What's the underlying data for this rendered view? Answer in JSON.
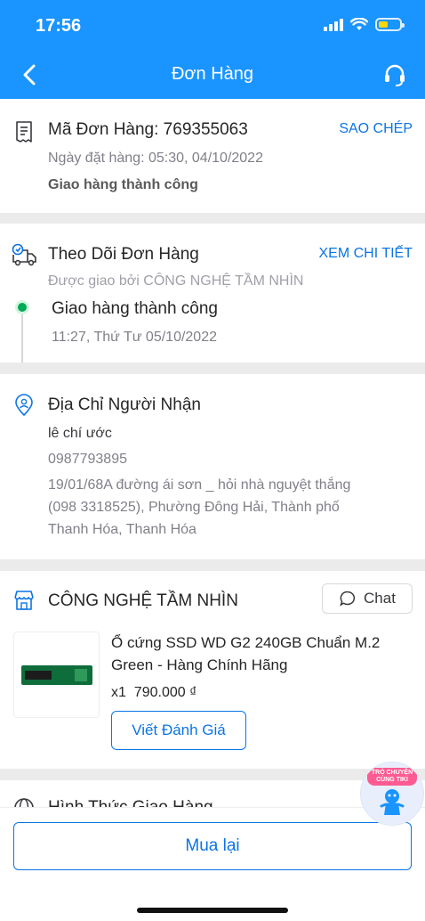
{
  "status_bar": {
    "time": "17:56"
  },
  "header": {
    "title": "Đơn Hàng"
  },
  "order": {
    "code_label": "Mã Đơn Hàng: 769355063",
    "copy_label": "SAO CHÉP",
    "order_date": "Ngày đặt hàng: 05:30, 04/10/2022",
    "status": "Giao hàng thành công"
  },
  "tracking": {
    "title": "Theo Dõi Đơn Hàng",
    "detail_label": "XEM CHI TIẾT",
    "carrier": "Được giao bởi CÔNG NGHỆ TẦM NHÌN",
    "event_status": "Giao hàng thành công",
    "event_time": "11:27, Thứ Tư 05/10/2022"
  },
  "address": {
    "title": "Địa Chỉ Người Nhận",
    "name": "lê chí ước",
    "phone": "0987793895",
    "line1": "19/01/68A đường ái sơn _ hỏi nhà nguyệt thắng",
    "line2": "(098 3318525), Phường Đông Hải, Thành phố",
    "line3": "Thanh Hóa, Thanh Hóa"
  },
  "shop": {
    "name": "CÔNG NGHỆ TẦM NHÌN",
    "chat_label": "Chat",
    "product": {
      "name_line1": "Ổ cứng SSD WD G2 240GB Chuẩn M.2",
      "name_line2": "Green - Hàng Chính Hãng",
      "quantity": "x1",
      "price": "790.000 ₫"
    },
    "review_label": "Viết Đánh Giá"
  },
  "shipping": {
    "title": "Hình Thức Giao Hàng"
  },
  "mascot": {
    "line1": "TRÒ CHUYỆN",
    "line2": "CÙNG TIKI"
  },
  "bottom": {
    "reorder_label": "Mua lại"
  },
  "colors": {
    "primary": "#1a94ff",
    "link": "#0b74e5",
    "success": "#00ab56"
  }
}
